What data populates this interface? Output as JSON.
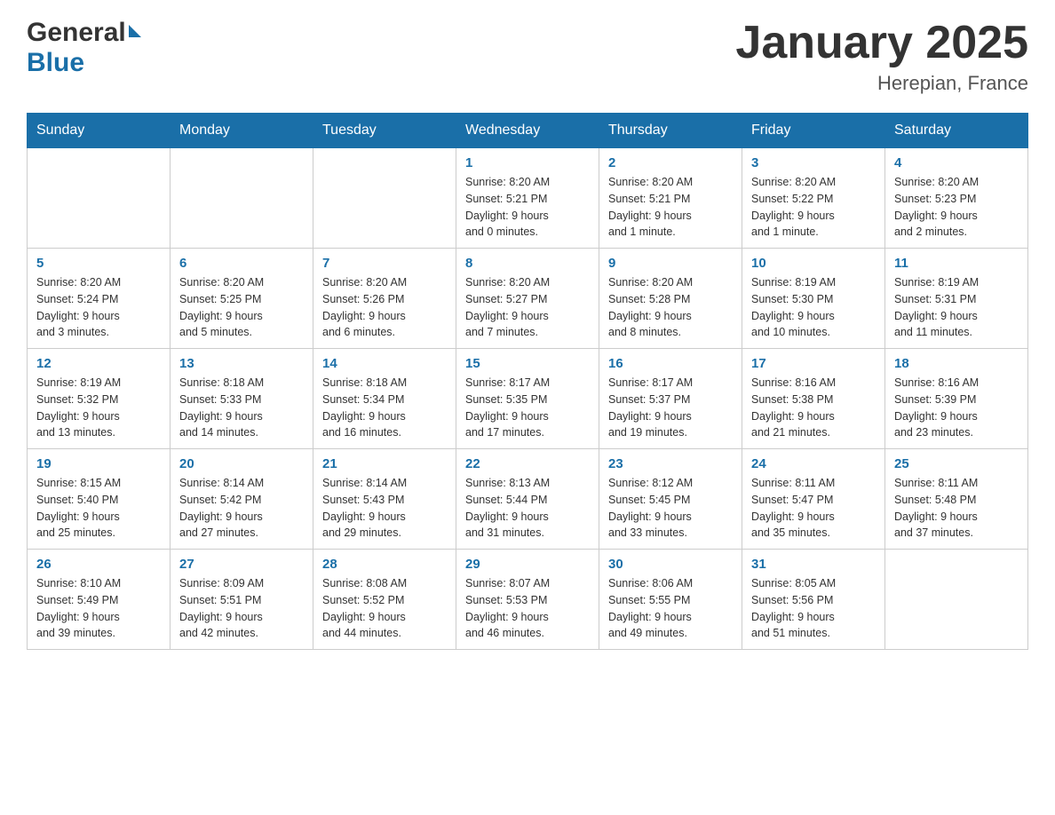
{
  "header": {
    "title": "January 2025",
    "location": "Herepian, France",
    "logo_general": "General",
    "logo_blue": "Blue"
  },
  "days_of_week": [
    "Sunday",
    "Monday",
    "Tuesday",
    "Wednesday",
    "Thursday",
    "Friday",
    "Saturday"
  ],
  "weeks": [
    [
      {
        "day": "",
        "info": ""
      },
      {
        "day": "",
        "info": ""
      },
      {
        "day": "",
        "info": ""
      },
      {
        "day": "1",
        "info": "Sunrise: 8:20 AM\nSunset: 5:21 PM\nDaylight: 9 hours\nand 0 minutes."
      },
      {
        "day": "2",
        "info": "Sunrise: 8:20 AM\nSunset: 5:21 PM\nDaylight: 9 hours\nand 1 minute."
      },
      {
        "day": "3",
        "info": "Sunrise: 8:20 AM\nSunset: 5:22 PM\nDaylight: 9 hours\nand 1 minute."
      },
      {
        "day": "4",
        "info": "Sunrise: 8:20 AM\nSunset: 5:23 PM\nDaylight: 9 hours\nand 2 minutes."
      }
    ],
    [
      {
        "day": "5",
        "info": "Sunrise: 8:20 AM\nSunset: 5:24 PM\nDaylight: 9 hours\nand 3 minutes."
      },
      {
        "day": "6",
        "info": "Sunrise: 8:20 AM\nSunset: 5:25 PM\nDaylight: 9 hours\nand 5 minutes."
      },
      {
        "day": "7",
        "info": "Sunrise: 8:20 AM\nSunset: 5:26 PM\nDaylight: 9 hours\nand 6 minutes."
      },
      {
        "day": "8",
        "info": "Sunrise: 8:20 AM\nSunset: 5:27 PM\nDaylight: 9 hours\nand 7 minutes."
      },
      {
        "day": "9",
        "info": "Sunrise: 8:20 AM\nSunset: 5:28 PM\nDaylight: 9 hours\nand 8 minutes."
      },
      {
        "day": "10",
        "info": "Sunrise: 8:19 AM\nSunset: 5:30 PM\nDaylight: 9 hours\nand 10 minutes."
      },
      {
        "day": "11",
        "info": "Sunrise: 8:19 AM\nSunset: 5:31 PM\nDaylight: 9 hours\nand 11 minutes."
      }
    ],
    [
      {
        "day": "12",
        "info": "Sunrise: 8:19 AM\nSunset: 5:32 PM\nDaylight: 9 hours\nand 13 minutes."
      },
      {
        "day": "13",
        "info": "Sunrise: 8:18 AM\nSunset: 5:33 PM\nDaylight: 9 hours\nand 14 minutes."
      },
      {
        "day": "14",
        "info": "Sunrise: 8:18 AM\nSunset: 5:34 PM\nDaylight: 9 hours\nand 16 minutes."
      },
      {
        "day": "15",
        "info": "Sunrise: 8:17 AM\nSunset: 5:35 PM\nDaylight: 9 hours\nand 17 minutes."
      },
      {
        "day": "16",
        "info": "Sunrise: 8:17 AM\nSunset: 5:37 PM\nDaylight: 9 hours\nand 19 minutes."
      },
      {
        "day": "17",
        "info": "Sunrise: 8:16 AM\nSunset: 5:38 PM\nDaylight: 9 hours\nand 21 minutes."
      },
      {
        "day": "18",
        "info": "Sunrise: 8:16 AM\nSunset: 5:39 PM\nDaylight: 9 hours\nand 23 minutes."
      }
    ],
    [
      {
        "day": "19",
        "info": "Sunrise: 8:15 AM\nSunset: 5:40 PM\nDaylight: 9 hours\nand 25 minutes."
      },
      {
        "day": "20",
        "info": "Sunrise: 8:14 AM\nSunset: 5:42 PM\nDaylight: 9 hours\nand 27 minutes."
      },
      {
        "day": "21",
        "info": "Sunrise: 8:14 AM\nSunset: 5:43 PM\nDaylight: 9 hours\nand 29 minutes."
      },
      {
        "day": "22",
        "info": "Sunrise: 8:13 AM\nSunset: 5:44 PM\nDaylight: 9 hours\nand 31 minutes."
      },
      {
        "day": "23",
        "info": "Sunrise: 8:12 AM\nSunset: 5:45 PM\nDaylight: 9 hours\nand 33 minutes."
      },
      {
        "day": "24",
        "info": "Sunrise: 8:11 AM\nSunset: 5:47 PM\nDaylight: 9 hours\nand 35 minutes."
      },
      {
        "day": "25",
        "info": "Sunrise: 8:11 AM\nSunset: 5:48 PM\nDaylight: 9 hours\nand 37 minutes."
      }
    ],
    [
      {
        "day": "26",
        "info": "Sunrise: 8:10 AM\nSunset: 5:49 PM\nDaylight: 9 hours\nand 39 minutes."
      },
      {
        "day": "27",
        "info": "Sunrise: 8:09 AM\nSunset: 5:51 PM\nDaylight: 9 hours\nand 42 minutes."
      },
      {
        "day": "28",
        "info": "Sunrise: 8:08 AM\nSunset: 5:52 PM\nDaylight: 9 hours\nand 44 minutes."
      },
      {
        "day": "29",
        "info": "Sunrise: 8:07 AM\nSunset: 5:53 PM\nDaylight: 9 hours\nand 46 minutes."
      },
      {
        "day": "30",
        "info": "Sunrise: 8:06 AM\nSunset: 5:55 PM\nDaylight: 9 hours\nand 49 minutes."
      },
      {
        "day": "31",
        "info": "Sunrise: 8:05 AM\nSunset: 5:56 PM\nDaylight: 9 hours\nand 51 minutes."
      },
      {
        "day": "",
        "info": ""
      }
    ]
  ]
}
